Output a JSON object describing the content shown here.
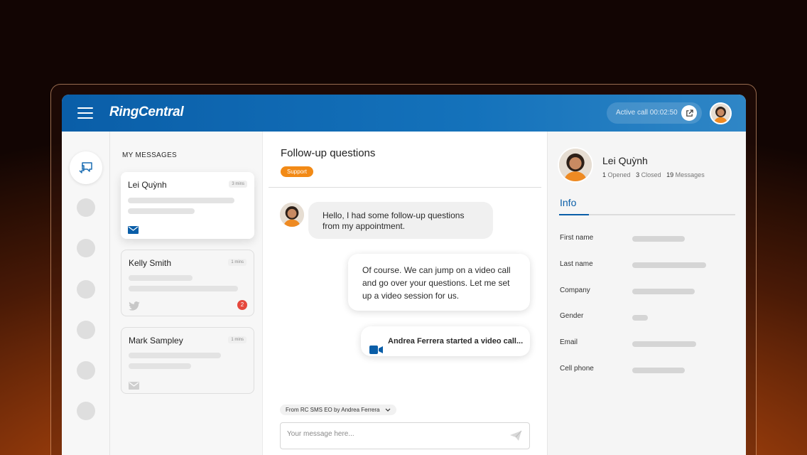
{
  "app": {
    "brand": "RingCentral",
    "active_call_label": "Active call 00:02:50"
  },
  "colors": {
    "brand_blue": "#0a5ea8",
    "tag_orange": "#f28a16",
    "badge_red": "#e5483d"
  },
  "messages": {
    "title": "MY MESSAGES",
    "items": [
      {
        "name": "Lei Quỳnh",
        "time": "3 mins",
        "icon": "envelope-icon",
        "badge": ""
      },
      {
        "name": "Kelly Smith",
        "time": "1 mins",
        "icon": "twitter-icon",
        "badge": "2"
      },
      {
        "name": "Mark Sampley",
        "time": "1 mins",
        "icon": "envelope-icon",
        "badge": ""
      }
    ]
  },
  "conversation": {
    "title": "Follow-up questions",
    "tag": "Support",
    "incoming": "Hello, I had some follow-up questions from my appointment.",
    "outgoing": "Of course. We can jump on a video call and go over your questions. Let me set up a video session for us.",
    "video_notice": "Andrea Ferrera started a video call...",
    "from_chip": "From RC SMS EO by Andrea Ferrera",
    "composer_placeholder": "Your message here..."
  },
  "profile": {
    "name": "Lei Quỳnh",
    "opened_count": "1",
    "opened_label": "Opened",
    "closed_count": "3",
    "closed_label": "Closed",
    "messages_count": "19",
    "messages_label": "Messages",
    "tab": "Info",
    "fields": [
      "First name",
      "Last name",
      "Company",
      "Gender",
      "Email",
      "Cell phone"
    ]
  }
}
